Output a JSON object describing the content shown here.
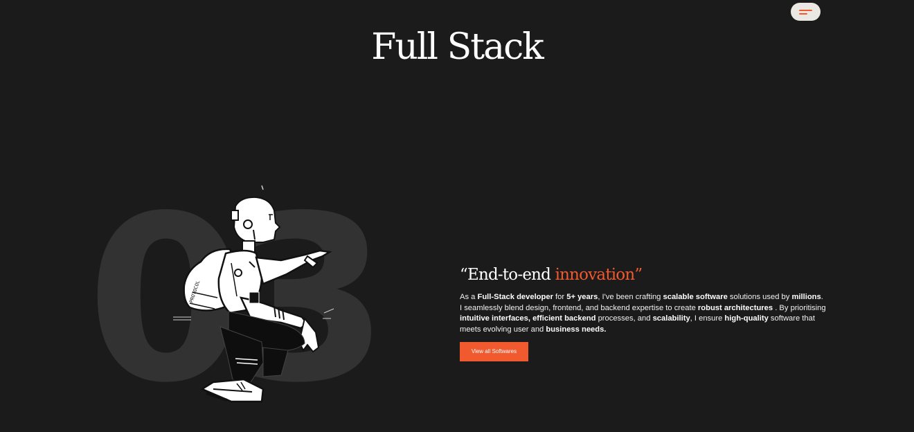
{
  "header": {
    "title": "Full Stack",
    "menu_icon": "hamburger-menu-icon"
  },
  "hero": {
    "number": "03",
    "illustration": "crouching-robot-pointing-illustration"
  },
  "content": {
    "quote_open": "“End-to-end ",
    "quote_accent": "innovation",
    "quote_close": "”",
    "description": [
      {
        "t": "As a ",
        "b": false
      },
      {
        "t": "Full-Stack developer",
        "b": true
      },
      {
        "t": " for ",
        "b": false
      },
      {
        "t": "5+ years",
        "b": true
      },
      {
        "t": ", I've been crafting ",
        "b": false
      },
      {
        "t": "scalable software",
        "b": true
      },
      {
        "t": " solutions used by ",
        "b": false
      },
      {
        "t": "millions",
        "b": true
      },
      {
        "t": ". I seamlessly blend design, frontend, and backend expertise to create ",
        "b": false
      },
      {
        "t": "robust architectures",
        "b": true
      },
      {
        "t": " . By prioritising ",
        "b": false
      },
      {
        "t": "intuitive interfaces, efficient backend",
        "b": true
      },
      {
        "t": " processes, and ",
        "b": false
      },
      {
        "t": "scalability",
        "b": true
      },
      {
        "t": ", I ensure ",
        "b": false
      },
      {
        "t": "high-quality",
        "b": true
      },
      {
        "t": " software that meets evolving user and ",
        "b": false
      },
      {
        "t": "business needs.",
        "b": true
      }
    ],
    "cta_label": "View all Softwares"
  },
  "colors": {
    "background": "#1b1b1b",
    "accent": "#f15a2e",
    "number": "#323232",
    "menu_bg": "#ebe7e2"
  }
}
